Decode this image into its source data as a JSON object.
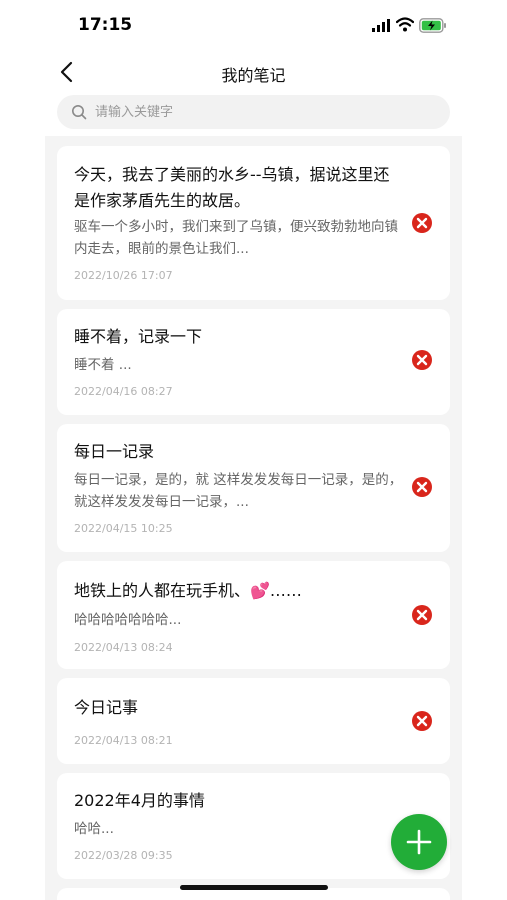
{
  "status_bar": {
    "time": "17:15"
  },
  "nav": {
    "title": "我的笔记"
  },
  "search": {
    "placeholder": "请输入关键字"
  },
  "notes": [
    {
      "title": "今天，我去了美丽的水乡--乌镇，据说这里还是作家茅盾先生的故居。",
      "preview": "驱车一个多小时，我们来到了乌镇，便兴致勃勃地向镇内走去，眼前的景色让我们...",
      "date": "2022/10/26 17:07"
    },
    {
      "title": "睡不着，记录一下",
      "preview": "睡不着 ...",
      "date": "2022/04/16 08:27"
    },
    {
      "title": "每日一记录",
      "preview": "每日一记录，是的，就 这样发发发每日一记录，是的，就这样发发发每日一记录，...",
      "date": "2022/04/15 10:25"
    },
    {
      "title": "地铁上的人都在玩手机、💕……",
      "preview": "哈哈哈哈哈哈哈...",
      "date": "2022/04/13 08:24"
    },
    {
      "title": "今日记事",
      "preview": "",
      "date": "2022/04/13 08:21"
    },
    {
      "title": "2022年4月的事情",
      "preview": "哈哈...",
      "date": "2022/03/28 09:35"
    }
  ],
  "icons": {
    "back": "chevron-left-icon",
    "search": "search-icon",
    "delete": "delete-circle-icon",
    "add": "plus-icon"
  },
  "colors": {
    "accent": "#22ad38",
    "delete": "#d9261c",
    "list_bg": "#f4f4f4"
  }
}
